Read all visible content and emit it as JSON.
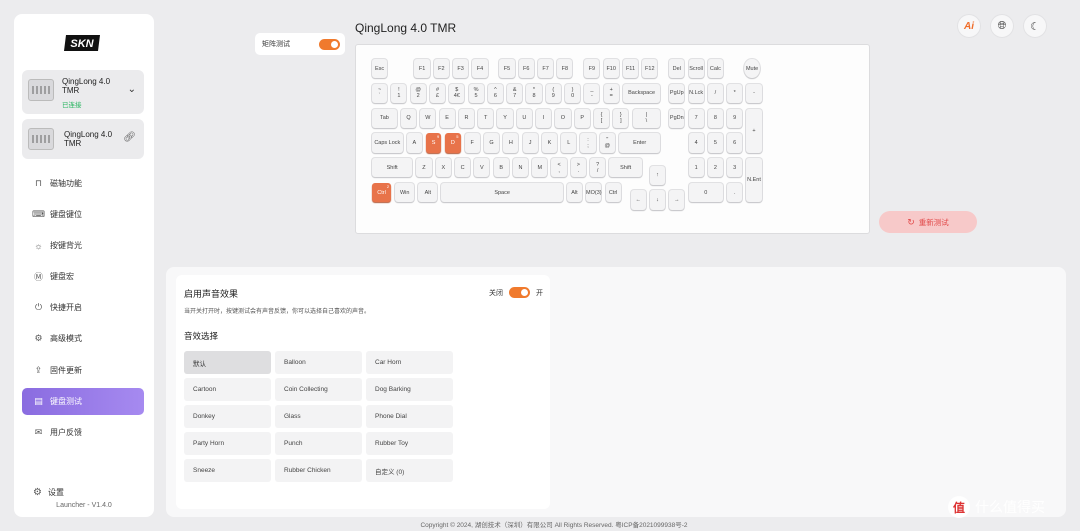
{
  "sidebar": {
    "logo": "SKN",
    "devices": [
      {
        "name": "QingLong 4.0 TMR",
        "status": "已连接"
      },
      {
        "name": "QingLong 4.0 TMR"
      }
    ],
    "nav": [
      {
        "label": "磁轴功能",
        "icon": "magnet-icon"
      },
      {
        "label": "键盘键位",
        "icon": "keyboard-icon"
      },
      {
        "label": "按键背光",
        "icon": "light-icon"
      },
      {
        "label": "键盘宏",
        "icon": "macro-icon"
      },
      {
        "label": "快捷开启",
        "icon": "power-icon"
      },
      {
        "label": "高级模式",
        "icon": "gear-icon"
      },
      {
        "label": "固件更新",
        "icon": "update-icon"
      },
      {
        "label": "键盘测试",
        "icon": "test-icon",
        "active": true
      },
      {
        "label": "用户反馈",
        "icon": "feedback-icon"
      }
    ],
    "settings_label": "设置",
    "version": "Launcher - V1.4.0"
  },
  "header": {
    "matrix_label": "矩阵测试",
    "title": "QingLong 4.0 TMR",
    "icons": [
      "ai-icon",
      "globe-icon",
      "moon-icon"
    ]
  },
  "keyboard": {
    "rows": [
      [
        [
          "Esc",
          ""
        ],
        [
          "F1",
          ""
        ],
        [
          "F2",
          ""
        ],
        [
          "F3",
          ""
        ],
        [
          "F4",
          ""
        ],
        [
          "F5",
          ""
        ],
        [
          "F6",
          ""
        ],
        [
          "F7",
          ""
        ],
        [
          "F8",
          ""
        ],
        [
          "F9",
          ""
        ],
        [
          "F10",
          ""
        ],
        [
          "F11",
          ""
        ],
        [
          "F12",
          ""
        ],
        [
          "Del",
          ""
        ],
        [
          "Scroll",
          ""
        ],
        [
          "Calc",
          ""
        ],
        [
          "Mute",
          ""
        ]
      ],
      [
        [
          "~\n`",
          ""
        ],
        [
          "!\n1",
          ""
        ],
        [
          "@\n2",
          ""
        ],
        [
          "#\n£",
          ""
        ],
        [
          "$\n4€",
          ""
        ],
        [
          "%\n5",
          ""
        ],
        [
          "^\n6",
          ""
        ],
        [
          "&\n7",
          ""
        ],
        [
          "*\n8",
          ""
        ],
        [
          "(\n9",
          ""
        ],
        [
          ")\n0",
          ""
        ],
        [
          "_\n-",
          ""
        ],
        [
          "+\n=",
          ""
        ],
        [
          "Backspace",
          ""
        ],
        [
          "PgUp",
          ""
        ],
        [
          "N.Lck",
          ""
        ],
        [
          "/",
          ""
        ],
        [
          "*",
          ""
        ],
        [
          "-",
          ""
        ]
      ],
      [
        [
          "Tab",
          ""
        ],
        [
          "Q",
          ""
        ],
        [
          "W",
          ""
        ],
        [
          "E",
          ""
        ],
        [
          "R",
          ""
        ],
        [
          "T",
          ""
        ],
        [
          "Y",
          ""
        ],
        [
          "U",
          ""
        ],
        [
          "I",
          ""
        ],
        [
          "O",
          ""
        ],
        [
          "P",
          ""
        ],
        [
          "{\n[",
          ""
        ],
        [
          "}\n]",
          ""
        ],
        [
          "|\n\\",
          ""
        ],
        [
          "PgDn",
          ""
        ],
        [
          "7",
          ""
        ],
        [
          "8",
          ""
        ],
        [
          "9",
          ""
        ],
        [
          "+",
          ""
        ]
      ],
      [
        [
          "Caps Lock",
          ""
        ],
        [
          "A",
          ""
        ],
        [
          "S",
          "9"
        ],
        [
          "D",
          "5"
        ],
        [
          "F",
          ""
        ],
        [
          "G",
          ""
        ],
        [
          "H",
          ""
        ],
        [
          "J",
          ""
        ],
        [
          "K",
          ""
        ],
        [
          "L",
          ""
        ],
        [
          ":\n;",
          ""
        ],
        [
          "\"\n@",
          ""
        ],
        [
          "Enter",
          ""
        ],
        [
          "4",
          ""
        ],
        [
          "5",
          ""
        ],
        [
          "6",
          ""
        ]
      ],
      [
        [
          "Shift",
          ""
        ],
        [
          "Z",
          ""
        ],
        [
          "X",
          ""
        ],
        [
          "C",
          ""
        ],
        [
          "V",
          ""
        ],
        [
          "B",
          ""
        ],
        [
          "N",
          ""
        ],
        [
          "M",
          ""
        ],
        [
          "<\n,",
          ""
        ],
        [
          ">\n.",
          ""
        ],
        [
          "?\n/",
          ""
        ],
        [
          "Shift",
          ""
        ],
        [
          "↑",
          ""
        ],
        [
          "1",
          ""
        ],
        [
          "2",
          ""
        ],
        [
          "3",
          ""
        ],
        [
          "N.Ent",
          ""
        ]
      ],
      [
        [
          "Ctrl",
          "2"
        ],
        [
          "Win",
          ""
        ],
        [
          "Alt",
          ""
        ],
        [
          "Space",
          ""
        ],
        [
          "Alt",
          ""
        ],
        [
          "MO(3)",
          ""
        ],
        [
          "Ctrl",
          ""
        ],
        [
          "←",
          ""
        ],
        [
          "↓",
          ""
        ],
        [
          "→",
          ""
        ],
        [
          "0",
          ""
        ],
        [
          ".",
          ""
        ]
      ]
    ]
  },
  "retest_label": "重新测试",
  "sound": {
    "title": "启用声音效果",
    "desc": "当开关打开时，按键测试会有声音反馈，你可以选择自己喜欢的声音。",
    "off_label": "关闭",
    "on_label": "开",
    "subtitle": "音效选择",
    "options": [
      "默认",
      "Balloon",
      "Car Horn",
      "Cartoon",
      "Coin Collecting",
      "Dog Barking",
      "Donkey",
      "Glass",
      "Phone Dial",
      "Party Horn",
      "Punch",
      "Rubber Toy",
      "Sneeze",
      "Rubber Chicken",
      "自定义 (0)"
    ],
    "selected": "默认"
  },
  "footer": "Copyright © 2024, 湖创技术（深圳）有限公司 All Rights Reserved. 粤ICP备2021099938号-2",
  "watermark": "什么值得买",
  "accent": "#f07a2d",
  "nav_active": "#8a6ce0",
  "key_hot": "#e8734a"
}
